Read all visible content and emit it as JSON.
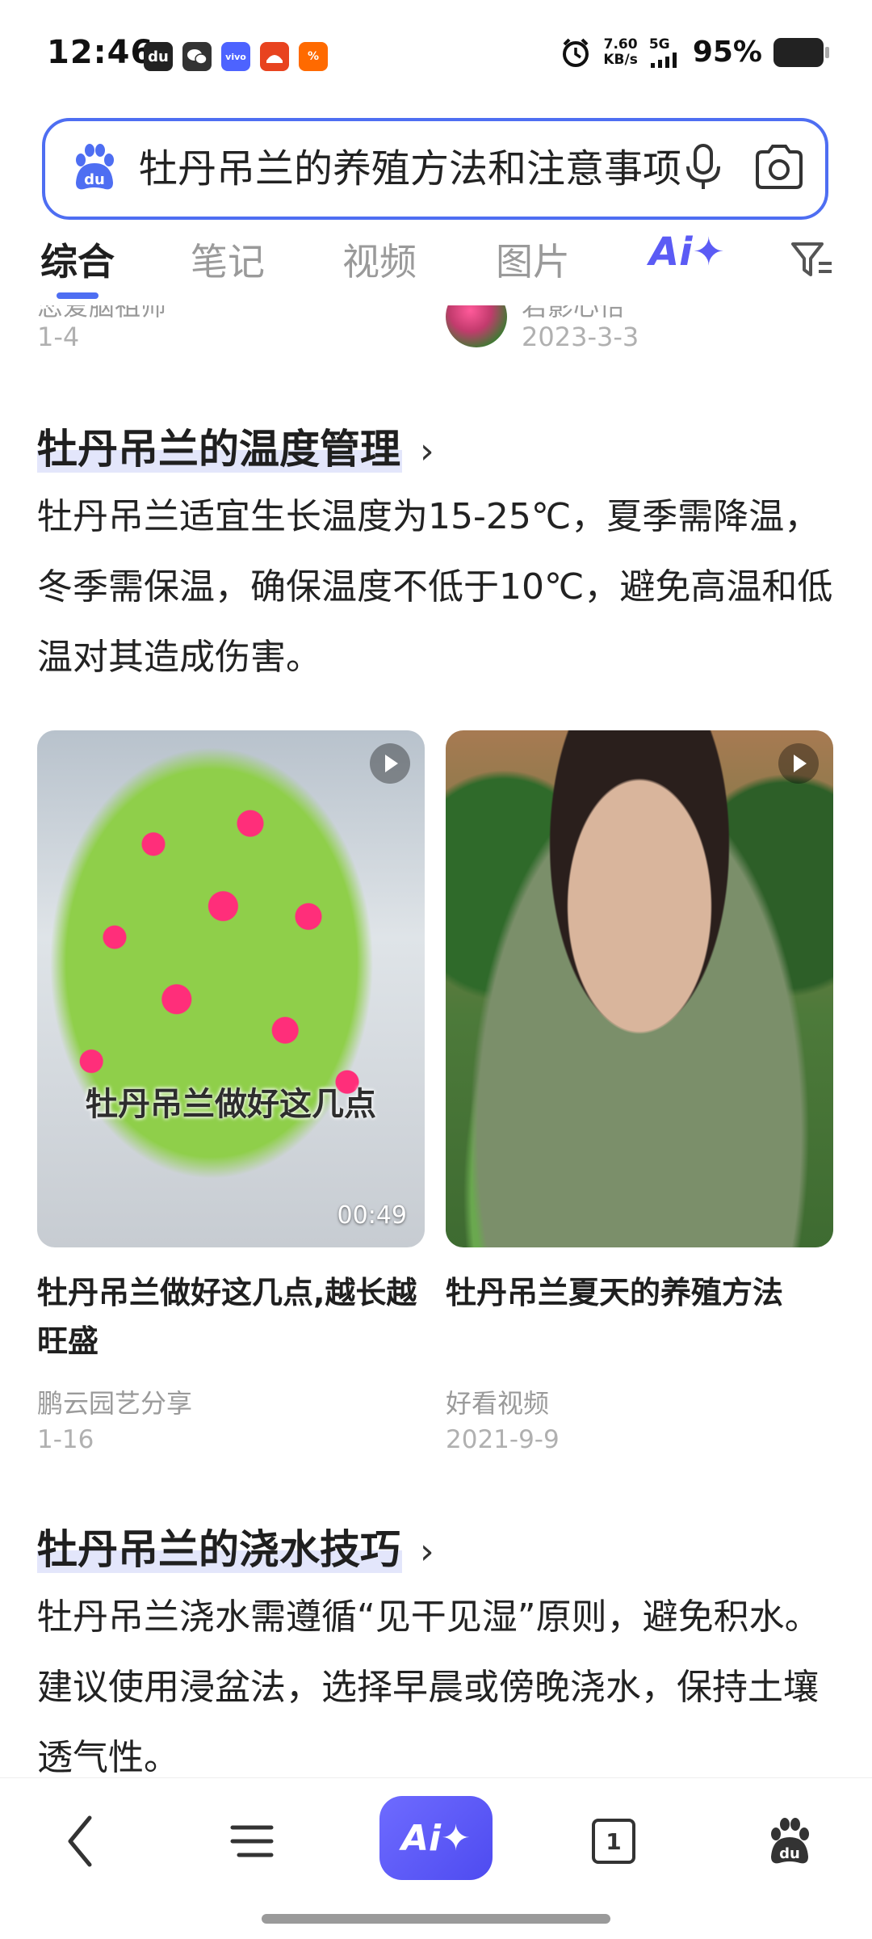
{
  "status_bar": {
    "time": "12:46",
    "net_speed_value": "7.60",
    "net_speed_unit": "KB/s",
    "network_type": "5G",
    "battery_percent": "95%",
    "app_icons": [
      "du-app-icon",
      "wechat-icon",
      "vivo-icon",
      "toutiao-icon",
      "app-badge-icon"
    ]
  },
  "search": {
    "query": "牡丹吊兰的养殖方法和注意事项"
  },
  "tabs": {
    "items": [
      "综合",
      "笔记",
      "视频",
      "图片"
    ],
    "active_index": 0,
    "ai_label": "Ai✦"
  },
  "top_meta": {
    "left_author": "恋爱脑祖师",
    "left_date": "1-4",
    "right_author": "君影心怡",
    "right_date": "2023-3-3"
  },
  "section1": {
    "title": "牡丹吊兰的温度管理",
    "chevron": "›",
    "text": "牡丹吊兰适宜生长温度为15-25℃，夏季需降温，冬季需保温，确保温度不低于10℃，避免高温和低温对其造成伤害。"
  },
  "videos": [
    {
      "overlay": "牡丹吊兰做好这几点",
      "duration": "00:49",
      "title": "牡丹吊兰做好这几点,越长越旺盛",
      "source": "鹏云园艺分享",
      "date": "1-16"
    },
    {
      "title": "牡丹吊兰夏天的养殖方法",
      "source": "好看视频",
      "date": "2021-9-9"
    }
  ],
  "section2": {
    "title": "牡丹吊兰的浇水技巧",
    "chevron": "›",
    "text": "牡丹吊兰浇水需遵循“见干见湿”原则，避免积水。建议使用浸盆法，选择早晨或傍晚浇水，保持土壤透气性。"
  },
  "bottom_nav": {
    "ai_label": "Ai✦",
    "tab_count": "1"
  },
  "colors": {
    "accent": "#4e6ef2",
    "ai_purple": "#5b5bf5",
    "highlight": "#e3e6fb",
    "muted_text": "#9a9a9a"
  }
}
